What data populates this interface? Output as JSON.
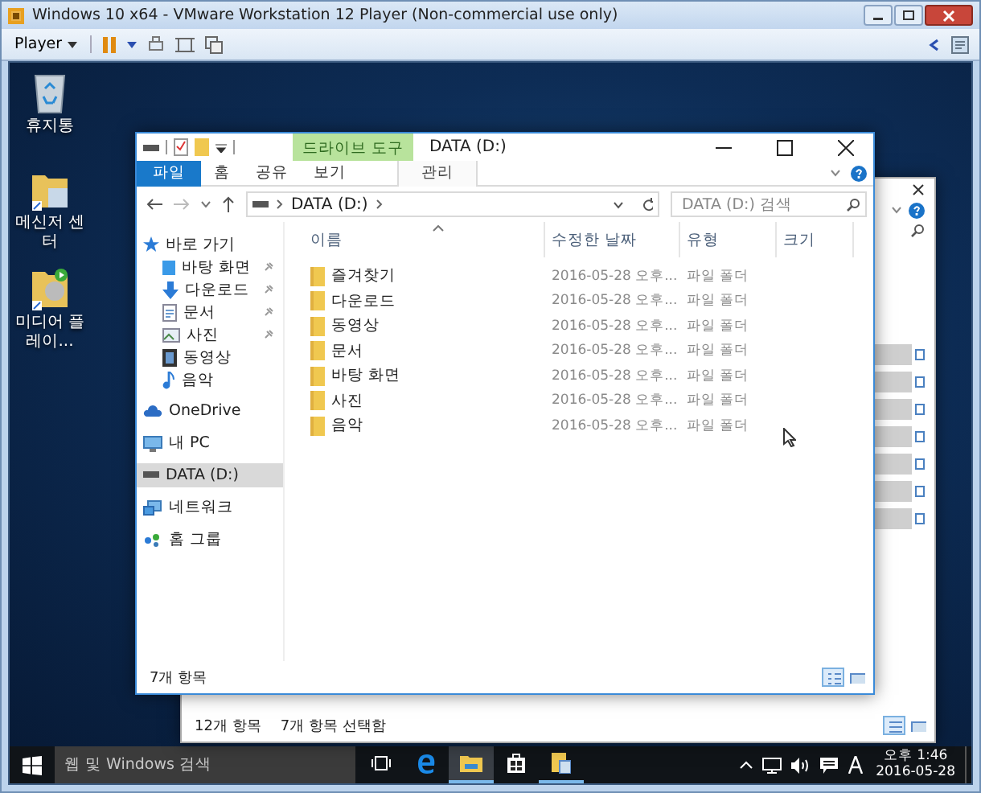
{
  "vm_window": {
    "title": "Windows 10 x64 - VMware Workstation 12 Player (Non-commercial use only)",
    "menu": "Player"
  },
  "desktop_icons": [
    {
      "label": "휴지통",
      "kind": "recycle"
    },
    {
      "label": "메신저 센터",
      "kind": "folder"
    },
    {
      "label": "미디어 플레이...",
      "kind": "media"
    }
  ],
  "back_window": {
    "status": [
      "12개 항목",
      "7개 항목 선택함"
    ]
  },
  "explorer": {
    "title": "DATA (D:)",
    "context_tab": "드라이브 도구",
    "ribbon_tabs": [
      {
        "label": "파일",
        "kind": "file"
      },
      {
        "label": "홈",
        "kind": "tab"
      },
      {
        "label": "공유",
        "kind": "tab"
      },
      {
        "label": "보기",
        "kind": "tab"
      },
      {
        "label": "관리",
        "kind": "context"
      }
    ],
    "address": {
      "path": "DATA (D:)"
    },
    "search": {
      "placeholder": "DATA (D:) 검색"
    },
    "nav": [
      {
        "label": "바로 가기",
        "kind": "star",
        "selected": false,
        "children": [
          {
            "label": "바탕 화면",
            "kind": "desktop",
            "pinned": true,
            "selected": false
          },
          {
            "label": "다운로드",
            "kind": "download",
            "pinned": true,
            "selected": false
          },
          {
            "label": "문서",
            "kind": "document",
            "pinned": true,
            "selected": false
          },
          {
            "label": "사진",
            "kind": "picture",
            "pinned": true,
            "selected": false
          },
          {
            "label": "동영상",
            "kind": "video",
            "pinned": false,
            "selected": false
          },
          {
            "label": "음악",
            "kind": "music",
            "pinned": false,
            "selected": false
          }
        ]
      },
      {
        "label": "OneDrive",
        "kind": "cloud",
        "selected": false
      },
      {
        "label": "내 PC",
        "kind": "pc",
        "selected": false
      },
      {
        "label": "DATA (D:)",
        "kind": "drive",
        "selected": true
      },
      {
        "label": "네트워크",
        "kind": "network",
        "selected": false
      },
      {
        "label": "홈 그룹",
        "kind": "homegroup",
        "selected": false
      }
    ],
    "columns": [
      "이름",
      "수정한 날짜",
      "유형",
      "크기"
    ],
    "rows": [
      {
        "name": "즐겨찾기",
        "modified": "2016-05-28 오후...",
        "type": "파일 폴더"
      },
      {
        "name": "다운로드",
        "modified": "2016-05-28 오후...",
        "type": "파일 폴더"
      },
      {
        "name": "동영상",
        "modified": "2016-05-28 오후...",
        "type": "파일 폴더"
      },
      {
        "name": "문서",
        "modified": "2016-05-28 오후...",
        "type": "파일 폴더"
      },
      {
        "name": "바탕 화면",
        "modified": "2016-05-28 오후...",
        "type": "파일 폴더"
      },
      {
        "name": "사진",
        "modified": "2016-05-28 오후...",
        "type": "파일 폴더"
      },
      {
        "name": "음악",
        "modified": "2016-05-28 오후...",
        "type": "파일 폴더"
      }
    ],
    "status": "7개 항목",
    "views": [
      {
        "kind": "details",
        "selected": true
      },
      {
        "kind": "thumbnails",
        "selected": false
      }
    ]
  },
  "taskbar": {
    "search_placeholder": "웹 및 Windows 검색",
    "apps": [
      {
        "kind": "taskview",
        "running": false,
        "selected": false
      },
      {
        "kind": "edge",
        "running": false,
        "selected": false
      },
      {
        "kind": "explorer",
        "running": true,
        "selected": true
      },
      {
        "kind": "store",
        "running": false,
        "selected": false
      },
      {
        "kind": "files",
        "running": true,
        "selected": false
      }
    ],
    "time": "오후 1:46",
    "date": "2016-05-28"
  }
}
